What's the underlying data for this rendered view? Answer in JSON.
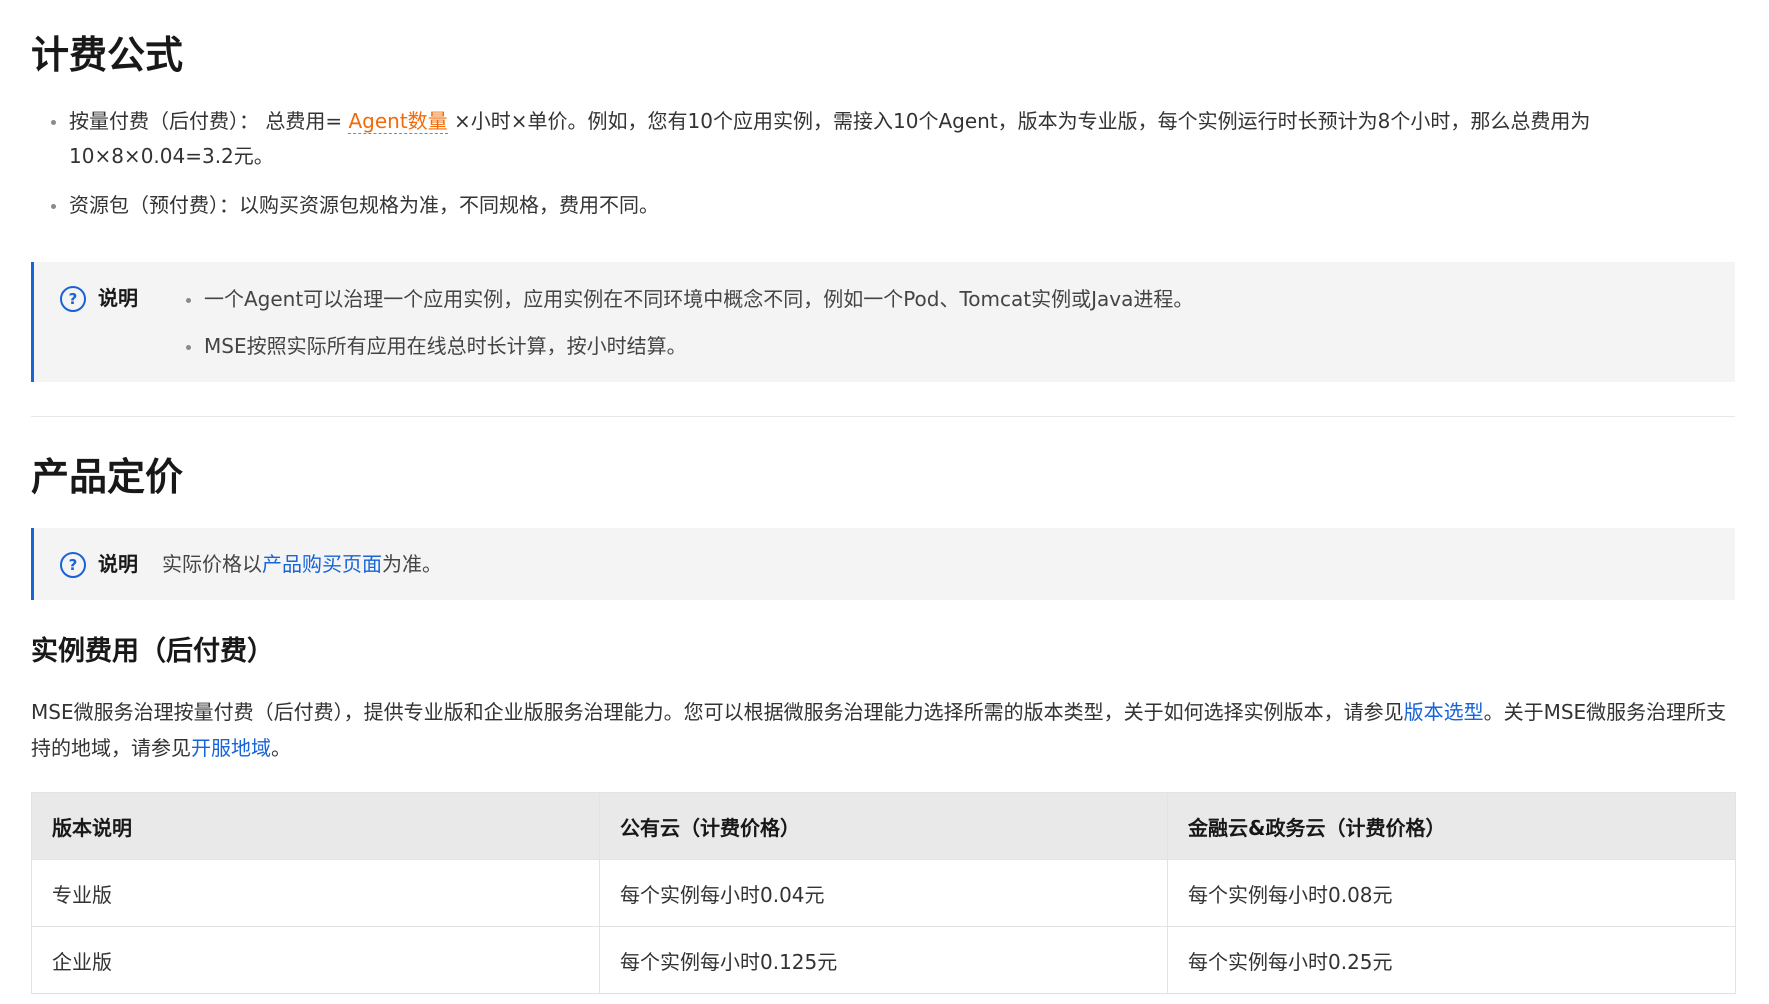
{
  "section1": {
    "title": "计费公式",
    "item1_prefix": "按量付费（后付费）： 总费用= ",
    "item1_term": "Agent数量",
    "item1_suffix": " ×小时×单价。例如，您有10个应用实例，需接入10个Agent，版本为专业版，每个实例运行时长预计为8个小时，那么总费用为10×8×0.04=3.2元。",
    "item2": "资源包（预付费）：以购买资源包规格为准，不同规格，费用不同。"
  },
  "note1": {
    "label": "说明",
    "items": [
      "一个Agent可以治理一个应用实例，应用实例在不同环境中概念不同，例如一个Pod、Tomcat实例或Java进程。",
      "MSE按照实际所有应用在线总时长计算，按小时结算。"
    ]
  },
  "section2": {
    "title": "产品定价"
  },
  "note2": {
    "label": "说明",
    "text_prefix": "实际价格以",
    "link": "产品购买页面",
    "text_suffix": "为准。"
  },
  "subsection": {
    "title": "实例费用（后付费）",
    "para_part1": "MSE微服务治理按量付费（后付费），提供专业版和企业版服务治理能力。您可以根据微服务治理能力选择所需的版本类型，关于如何选择实例版本，请参见",
    "link1": "版本选型",
    "para_part2": "。关于MSE微服务治理所支持的地域，请参见",
    "link2": "开服地域",
    "para_part3": "。"
  },
  "table": {
    "headers": [
      "版本说明",
      "公有云（计费价格）",
      "金融云&政务云（计费价格）"
    ],
    "rows": [
      [
        "专业版",
        "每个实例每小时0.04元",
        "每个实例每小时0.08元"
      ],
      [
        "企业版",
        "每个实例每小时0.125元",
        "每个实例每小时0.25元"
      ]
    ]
  }
}
